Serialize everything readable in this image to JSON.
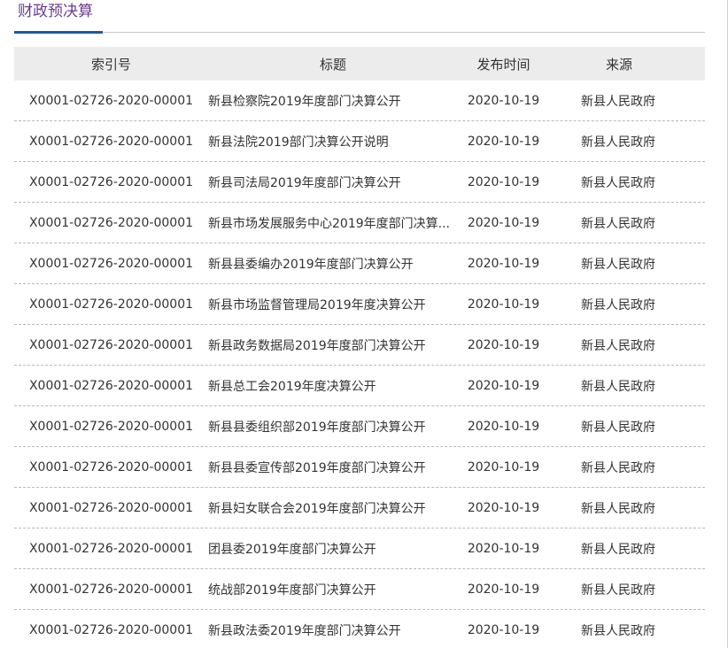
{
  "section": {
    "title": "财政预决算"
  },
  "table": {
    "headers": [
      "索引号",
      "标题",
      "发布时间",
      "来源"
    ],
    "rows": [
      {
        "index": "X0001-02726-2020-00001",
        "title": "新县检察院2019年度部门决算公开",
        "date": "2020-10-19",
        "source": "新县人民政府"
      },
      {
        "index": "X0001-02726-2020-00001",
        "title": "新县法院2019部门决算公开说明",
        "date": "2020-10-19",
        "source": "新县人民政府"
      },
      {
        "index": "X0001-02726-2020-00001",
        "title": "新县司法局2019年度部门决算公开",
        "date": "2020-10-19",
        "source": "新县人民政府"
      },
      {
        "index": "X0001-02726-2020-00001",
        "title": "新县市场发展服务中心2019年度部门决算...",
        "date": "2020-10-19",
        "source": "新县人民政府"
      },
      {
        "index": "X0001-02726-2020-00001",
        "title": "新县县委编办2019年度部门决算公开",
        "date": "2020-10-19",
        "source": "新县人民政府"
      },
      {
        "index": "X0001-02726-2020-00001",
        "title": "新县市场监督管理局2019年度决算公开",
        "date": "2020-10-19",
        "source": "新县人民政府"
      },
      {
        "index": "X0001-02726-2020-00001",
        "title": "新县政务数据局2019年度部门决算公开",
        "date": "2020-10-19",
        "source": "新县人民政府"
      },
      {
        "index": "X0001-02726-2020-00001",
        "title": "新县总工会2019年度决算公开",
        "date": "2020-10-19",
        "source": "新县人民政府"
      },
      {
        "index": "X0001-02726-2020-00001",
        "title": "新县县委组织部2019年度部门决算公开",
        "date": "2020-10-19",
        "source": "新县人民政府"
      },
      {
        "index": "X0001-02726-2020-00001",
        "title": "新县县委宣传部2019年度部门决算公开",
        "date": "2020-10-19",
        "source": "新县人民政府"
      },
      {
        "index": "X0001-02726-2020-00001",
        "title": "新县妇女联合会2019年度部门决算公开",
        "date": "2020-10-19",
        "source": "新县人民政府"
      },
      {
        "index": "X0001-02726-2020-00001",
        "title": "团县委2019年度部门决算公开",
        "date": "2020-10-19",
        "source": "新县人民政府"
      },
      {
        "index": "X0001-02726-2020-00001",
        "title": "统战部2019年度部门决算公开",
        "date": "2020-10-19",
        "source": "新县人民政府"
      },
      {
        "index": "X0001-02726-2020-00001",
        "title": "新县政法委2019年度部门决算公开",
        "date": "2020-10-19",
        "source": "新县人民政府"
      }
    ]
  },
  "colors": {
    "title": "#6a3c8f",
    "accent": "#1a5a9c",
    "header_bg": "#ececec",
    "divider": "#b8b8b8"
  }
}
